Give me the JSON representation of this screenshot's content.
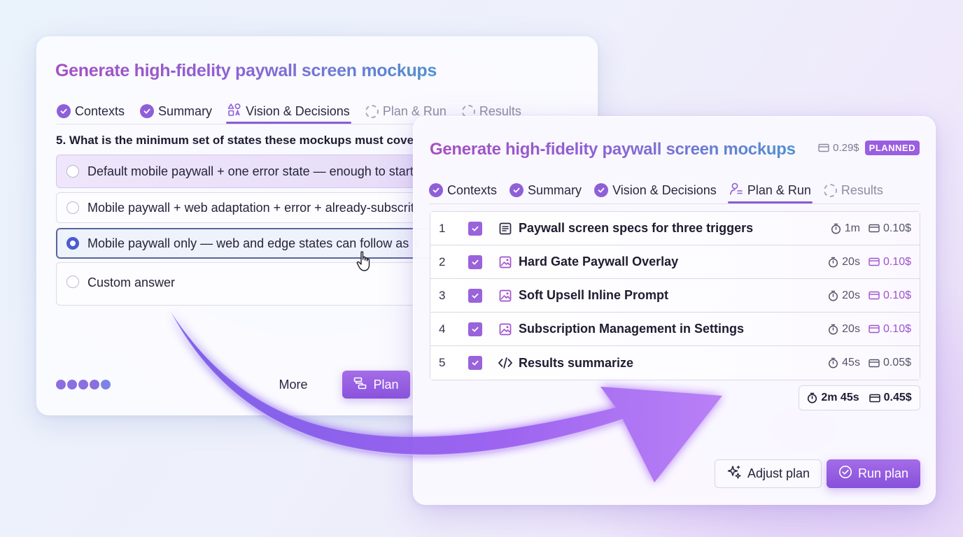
{
  "back_card": {
    "title": "Generate high-fidelity paywall screen mockups",
    "tabs": [
      {
        "label": "Contexts",
        "state": "done"
      },
      {
        "label": "Summary",
        "state": "done"
      },
      {
        "label": "Vision & Decisions",
        "state": "active"
      },
      {
        "label": "Plan & Run",
        "state": "pending"
      },
      {
        "label": "Results",
        "state": "pending"
      }
    ],
    "question": "5. What is the minimum set of states these mockups must cove",
    "options": [
      {
        "label": "Default mobile paywall + one error state — enough to start",
        "state": "highlighted"
      },
      {
        "label": "Mobile paywall + web adaptation + error + already-subscrit",
        "state": "default"
      },
      {
        "label": "Mobile paywall only — web and edge states can follow as a",
        "state": "selected"
      },
      {
        "label": "Custom answer",
        "state": "default"
      }
    ],
    "more_label": "More",
    "plan_label": "Plan"
  },
  "front_card": {
    "title": "Generate high-fidelity paywall screen mockups",
    "cost": "0.29$",
    "status_badge": "PLANNED",
    "tabs": [
      {
        "label": "Contexts",
        "state": "done"
      },
      {
        "label": "Summary",
        "state": "done"
      },
      {
        "label": "Vision & Decisions",
        "state": "done"
      },
      {
        "label": "Plan & Run",
        "state": "active"
      },
      {
        "label": "Results",
        "state": "pending"
      }
    ],
    "plan_items": [
      {
        "num": "1",
        "icon": "document-icon",
        "name": "Paywall screen specs for three triggers",
        "time": "1m",
        "cost": "0.10$",
        "accent": false
      },
      {
        "num": "2",
        "icon": "image-icon",
        "name": "Hard Gate Paywall Overlay",
        "time": "20s",
        "cost": "0.10$",
        "accent": true
      },
      {
        "num": "3",
        "icon": "image-icon",
        "name": "Soft Upsell Inline Prompt",
        "time": "20s",
        "cost": "0.10$",
        "accent": true
      },
      {
        "num": "4",
        "icon": "image-icon",
        "name": "Subscription Management in Settings",
        "time": "20s",
        "cost": "0.10$",
        "accent": true
      },
      {
        "num": "5",
        "icon": "code-icon",
        "name": "Results summarize",
        "time": "45s",
        "cost": "0.05$",
        "accent": false
      }
    ],
    "total_time": "2m 45s",
    "total_cost": "0.45$",
    "adjust_label": "Adjust plan",
    "run_label": "Run plan"
  },
  "colors": {
    "accent": "#8f5fd8",
    "accent_cost": "#a052cf",
    "arrow": "#9a62ee"
  }
}
